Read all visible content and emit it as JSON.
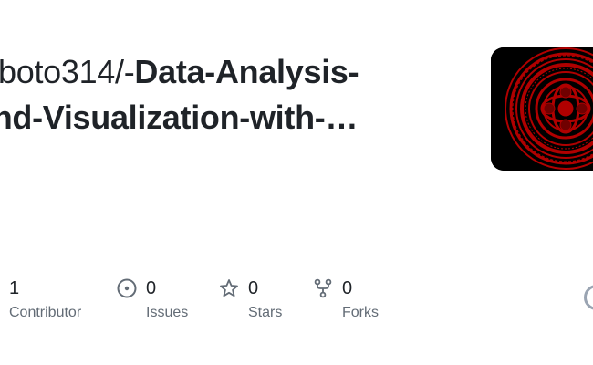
{
  "repo": {
    "owner_line": "boto314/-",
    "name_line1": "Data-Analysis-",
    "name_line2": "and-Visualization-with-…",
    "avatar_icon": "avatar-red-mandala-icon",
    "avatar_colors": {
      "background": "#000000",
      "pattern": "#b00000"
    }
  },
  "stats": {
    "contributors": {
      "value": "1",
      "label": "Contributor"
    },
    "issues": {
      "value": "0",
      "label": "Issues",
      "icon": "issue-opened-icon"
    },
    "stars": {
      "value": "0",
      "label": "Stars",
      "icon": "star-icon"
    },
    "forks": {
      "value": "0",
      "label": "Forks",
      "icon": "repo-forked-icon"
    }
  },
  "colors": {
    "title": "#1f2328",
    "muted": "#636c76"
  }
}
